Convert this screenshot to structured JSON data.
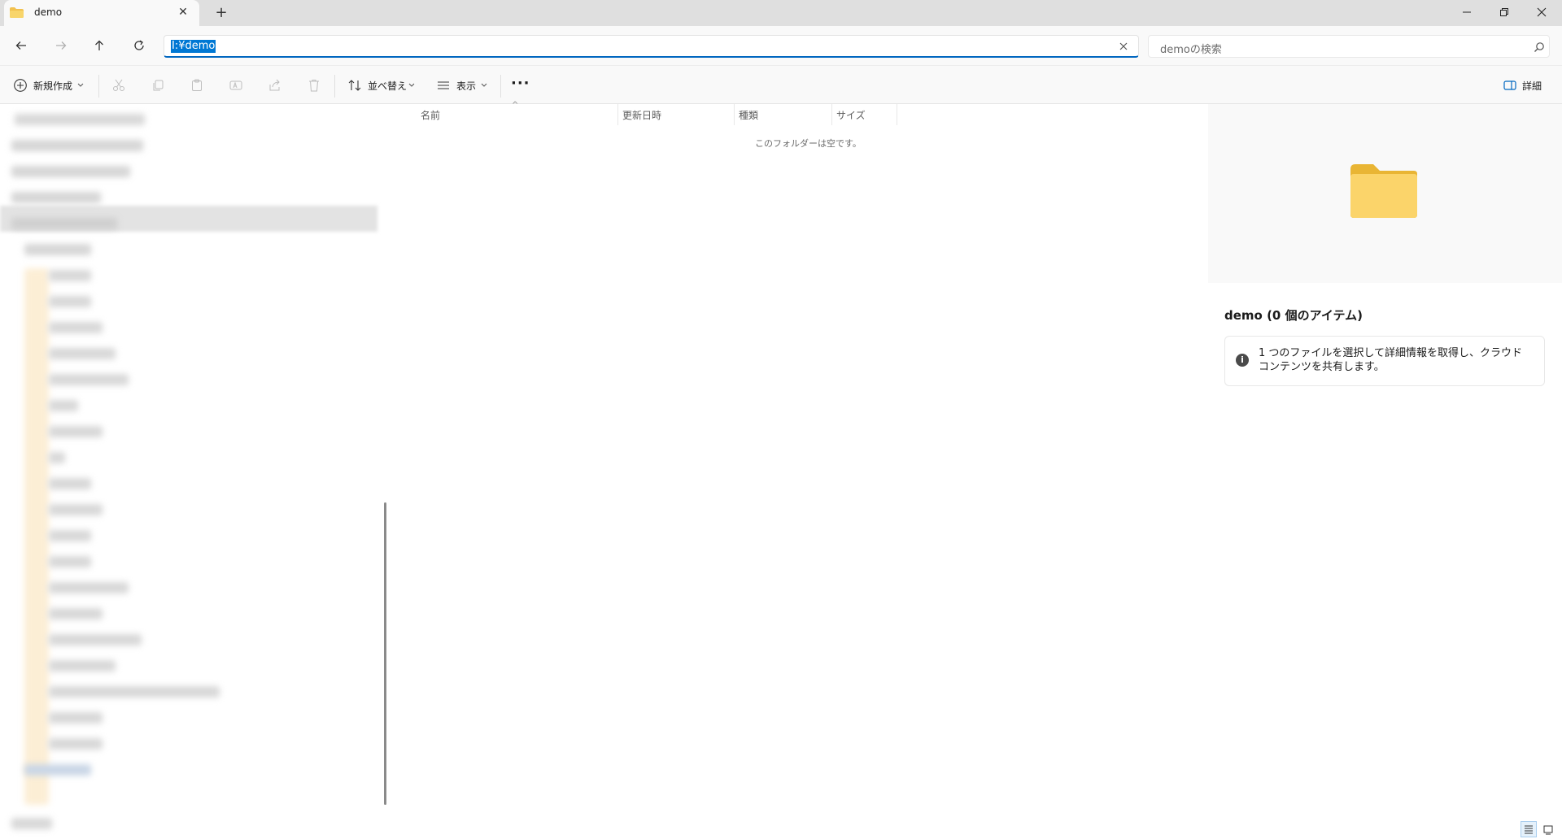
{
  "tab": {
    "title": "demo",
    "close": "✕",
    "new": "+"
  },
  "window": {
    "minimize": "—",
    "maximize": "❐",
    "close": "✕"
  },
  "address": {
    "path": "I:¥demo"
  },
  "search": {
    "placeholder": "demoの検索"
  },
  "toolbar": {
    "new_label": "新規作成",
    "sort_label": "並べ替え",
    "view_label": "表示",
    "more_label": "···",
    "details_label": "詳細"
  },
  "columns": {
    "name": "名前",
    "modified": "更新日時",
    "type": "種類",
    "size": "サイズ"
  },
  "content": {
    "empty_message": "このフォルダーは空です。",
    "sort_indicator": "^"
  },
  "details": {
    "title": "demo (0 個のアイテム)",
    "info_icon": "i",
    "info_text": "1 つのファイルを選択して詳細情報を取得し、クラウド コンテンツを共有します。"
  },
  "colors": {
    "accent": "#0078d4",
    "folder": "#f5c542"
  }
}
